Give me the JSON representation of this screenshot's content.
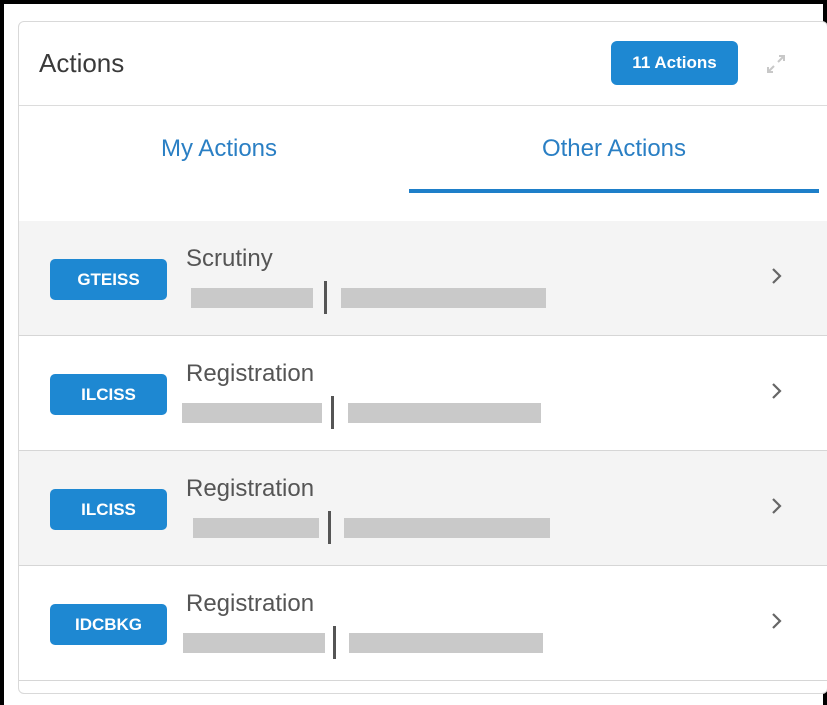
{
  "panel": {
    "title": "Actions",
    "count_badge": "11 Actions",
    "expand_icon": "expand-icon"
  },
  "tabs": [
    {
      "label": "My Actions",
      "active": false
    },
    {
      "label": "Other Actions",
      "active": true
    }
  ],
  "accent_color": "#1e88d2",
  "items": [
    {
      "tag": "GTEISS",
      "title": "Scrutiny"
    },
    {
      "tag": "ILCISS",
      "title": "Registration"
    },
    {
      "tag": "ILCISS",
      "title": "Registration"
    },
    {
      "tag": "IDCBKG",
      "title": "Registration"
    }
  ]
}
